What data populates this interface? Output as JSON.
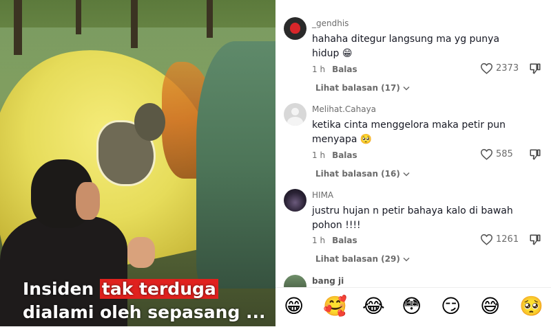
{
  "video": {
    "caption_before": "Insiden ",
    "caption_highlight": "tak terduga",
    "caption_after": " dialami oleh sepasang ..."
  },
  "comments": [
    {
      "username": "_gendhis",
      "text": "hahaha ditegur langsung ma yg punya hidup 😁",
      "time": "1 h",
      "reply_label": "Balas",
      "likes": "2373",
      "view_replies": "Lihat balasan (17)"
    },
    {
      "username": "Melihat.Cahaya",
      "text": "ketika cinta menggelora maka petir pun menyapa 🥺",
      "time": "1 h",
      "reply_label": "Balas",
      "likes": "585",
      "view_replies": "Lihat balasan (16)"
    },
    {
      "username": "HIMA",
      "text": "justru hujan n petir bahaya kalo di bawah pohon !!!!",
      "time": "1 h",
      "reply_label": "Balas",
      "likes": "1261",
      "view_replies": "Lihat balasan (29)"
    },
    {
      "username": "bang ji"
    }
  ],
  "emoji_bar": [
    "😁",
    "🥰",
    "😂",
    "😳",
    "😏",
    "😅",
    "🥺"
  ],
  "colors": {
    "caption_highlight": "#e0211e",
    "text_primary": "#161823",
    "text_secondary": "#6b6b6b"
  },
  "icons": [
    "heart-outline-icon",
    "thumbs-down-icon",
    "chevron-down-icon"
  ]
}
